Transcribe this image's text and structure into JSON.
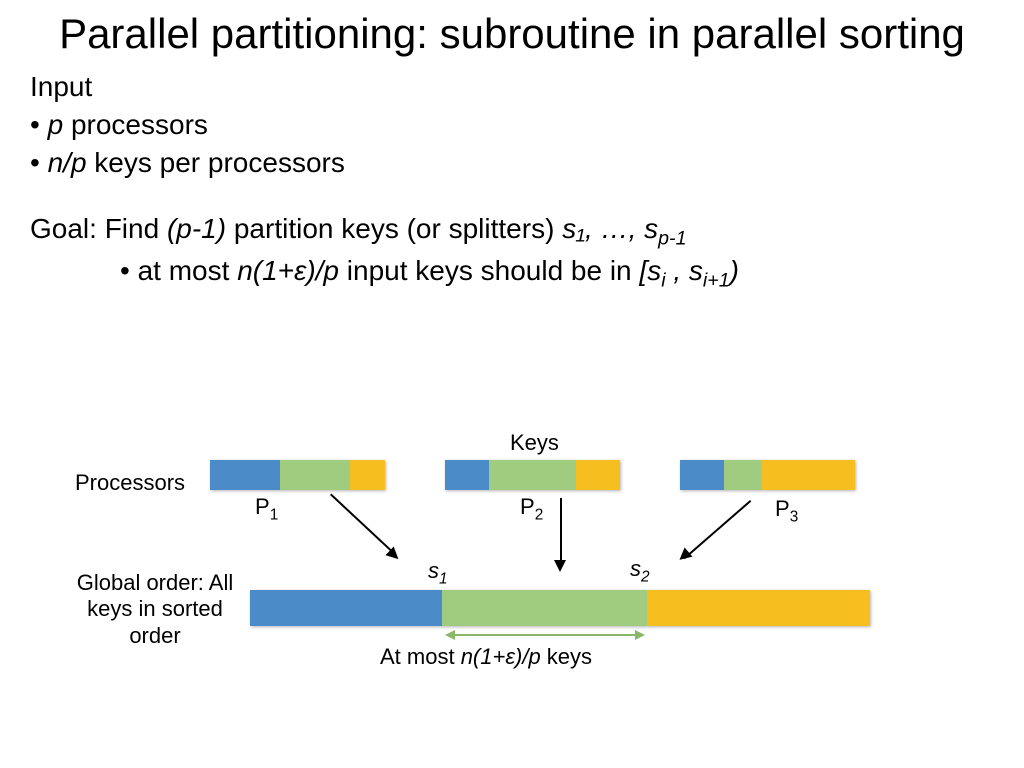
{
  "title": "Parallel partitioning: subroutine in parallel sorting",
  "input_header": "Input",
  "bullet1_pre": "p",
  "bullet1_post": " processors",
  "bullet2_pre": "n/p",
  "bullet2_post": " keys per processors",
  "goal_pre": "Goal: Find ",
  "goal_mid_italic": "(p-1)",
  "goal_post": " partition keys (or splitters) ",
  "goal_splitters": "s₁, …, s",
  "goal_splitters_sub": "p-1",
  "sub_pre": "at most ",
  "sub_mid": "n(1+ε)/p",
  "sub_post": " input keys should be in ",
  "sub_interval_a": "[s",
  "sub_interval_a_sub": "i",
  "sub_interval_b": " , s",
  "sub_interval_b_sub": "i+1",
  "sub_interval_c": ")",
  "diagram": {
    "keys_label": "Keys",
    "processors_label": "Processors",
    "global_order_label": "Global order: All keys in sorted order",
    "p1": "P",
    "p1_sub": "1",
    "p2": "P",
    "p2_sub": "2",
    "p3": "P",
    "p3_sub": "3",
    "s1": "s",
    "s1_sub": "1",
    "s2": "s",
    "s2_sub": "2",
    "bottom_pre": "At most  ",
    "bottom_mid": "n(1+ε)/p",
    "bottom_post": " keys",
    "colors": {
      "blue": "#4A8BC8",
      "green": "#9FCC7F",
      "gold": "#F7BE1F"
    }
  }
}
